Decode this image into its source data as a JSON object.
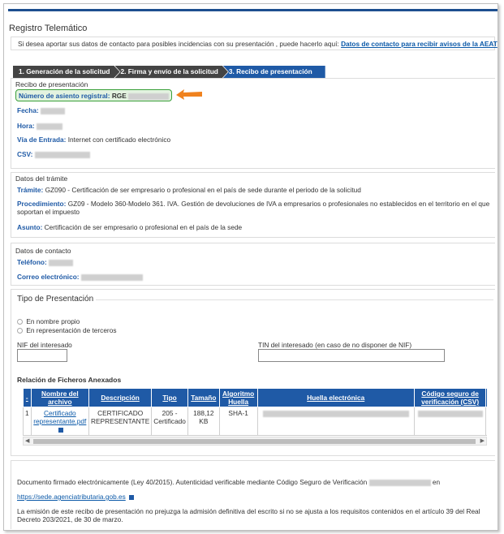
{
  "header": {
    "title": "Registro Telemático",
    "notice_text": "Si desea aportar sus datos de contacto para posibles incidencias con su presentación , puede hacerlo aquí:",
    "notice_link": "Datos de contacto para recibir avisos de la AEAT"
  },
  "steps": [
    {
      "label": "1. Generación de la solicitud"
    },
    {
      "label": "2. Firma y envío de la solicitud"
    },
    {
      "label": "3. Recibo de presentación"
    }
  ],
  "recibo": {
    "section_title": "Recibo de presentación",
    "asiento_label": "Número de asiento registral:",
    "asiento_prefix": "RGE",
    "fecha_label": "Fecha:",
    "hora_label": "Hora:",
    "via_label": "Vía de Entrada:",
    "via_value": "Internet con certificado electrónico",
    "csv_label": "CSV:"
  },
  "tramite": {
    "section_title": "Datos del trámite",
    "tramite_label": "Trámite:",
    "tramite_value": "GZ090 - Certificación de ser empresario o profesional en el país de sede durante el periodo de la solicitud",
    "procedimiento_label": "Procedimiento:",
    "procedimiento_value": "GZ09 - Modelo 360-Modelo 361. IVA. Gestión de devoluciones de IVA a empresarios o profesionales no establecidos en el territorio en el que soportan el impuesto",
    "asunto_label": "Asunto:",
    "asunto_value": "Certificación de ser empresario o profesional en el país de la sede"
  },
  "contacto": {
    "section_title": "Datos de contacto",
    "telefono_label": "Teléfono:",
    "correo_label": "Correo electrónico:"
  },
  "presentacion": {
    "section_title": "Tipo de Presentación",
    "option_propio": "En nombre propio",
    "option_terceros": "En representación de terceros",
    "nif_label": "NIF del interesado",
    "tin_label": "TIN del interesado (en caso de no disponer de NIF)"
  },
  "ficheros": {
    "section_title": "Relación de Ficheros Anexados",
    "columns": [
      "Nombre del archivo",
      "Descripción",
      "Tipo",
      "Tamaño",
      "Algoritmo Huella",
      "Huella electrónica",
      "Código seguro de verificación (CSV)"
    ],
    "row": {
      "index": "1",
      "nombre": "Certificado representante.pdf",
      "descripcion": "CERTIFICADO REPRESENTANTE",
      "tipo": "205 - Certificado",
      "tamano": "188,12 KB",
      "algoritmo": "SHA-1"
    }
  },
  "footer": {
    "firma_text": "Documento firmado electrónicamente (Ley 40/2015). Autenticidad verificable mediante Código Seguro de Verificación",
    "firma_suffix": "en",
    "sede_link": "https://sede.agenciatributaria.gob.es",
    "disclaimer": "La emisión de este recibo de presentación no prejuzga la admisión definitiva del escrito si no se ajusta a los requisitos contenidos en el artículo 39 del Real Decreto 203/2021, de 30 de marzo."
  },
  "colors": {
    "brand_blue": "#1f5aa6",
    "step_dark": "#444444",
    "highlight_green": "#3aa03a",
    "arrow_orange": "#f0821e"
  }
}
